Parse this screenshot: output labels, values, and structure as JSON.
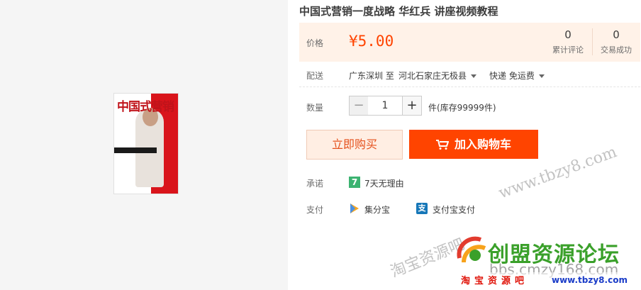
{
  "product": {
    "title": "中国式营销一度战略 华红兵 讲座视频教程",
    "book_cover_text": "中国式营销"
  },
  "price": {
    "label": "价格",
    "value": "¥5.00",
    "reviews_count": "0",
    "reviews_label": "累计评论",
    "sales_count": "0",
    "sales_label": "交易成功"
  },
  "delivery": {
    "label": "配送",
    "from": "广东深圳 至",
    "to": "河北石家庄无极县",
    "shipping": "快递 免运费"
  },
  "quantity": {
    "label": "数量",
    "minus": "−",
    "value": "1",
    "plus": "+",
    "stock": "件(库存99999件)"
  },
  "actions": {
    "buy_now": "立即购买",
    "add_to_cart": "加入购物车"
  },
  "promise": {
    "label": "承诺",
    "badge": "7",
    "text": "7天无理由"
  },
  "payment": {
    "label": "支付",
    "method1": "集分宝",
    "method2_icon": "支",
    "method2": "支付宝支付"
  },
  "watermarks": {
    "url": "www.tbzy8.com",
    "cn": "淘宝资源吧",
    "forum_name": "创盟资源论坛",
    "forum_url": "bbs.cmzy168.com",
    "footer_cn": "淘宝资源吧",
    "footer_url": "www.tbzy8.com"
  },
  "colors": {
    "accent": "#ff4400",
    "price_bg": "#fff2e8",
    "forum_green": "#3aa02a"
  }
}
